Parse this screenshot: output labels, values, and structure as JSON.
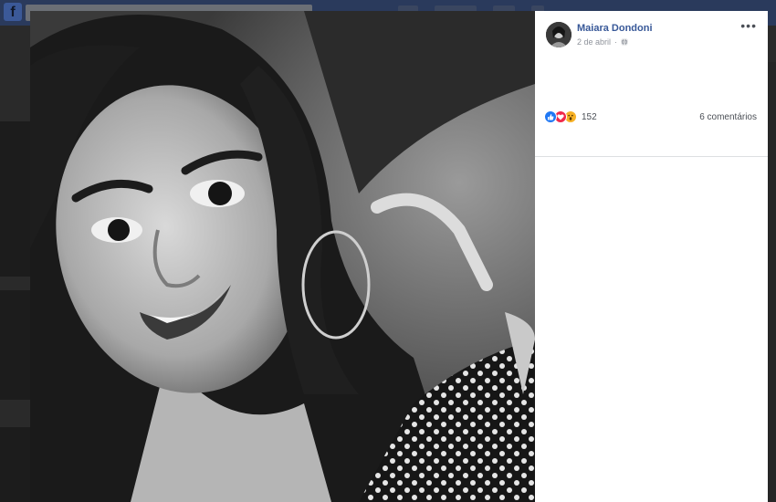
{
  "post": {
    "author": "Maiara Dondoni",
    "date": "2 de abril",
    "privacy_icon": "globe-icon",
    "more_label": "•••",
    "reaction_icons": [
      "like-icon",
      "love-icon",
      "wow-icon"
    ],
    "reaction_count": "152",
    "comments_label": "6 comentários"
  },
  "colors": {
    "author_link": "#385898",
    "like": "#2078f4",
    "love": "#f0284a",
    "wow": "#f7b125"
  }
}
